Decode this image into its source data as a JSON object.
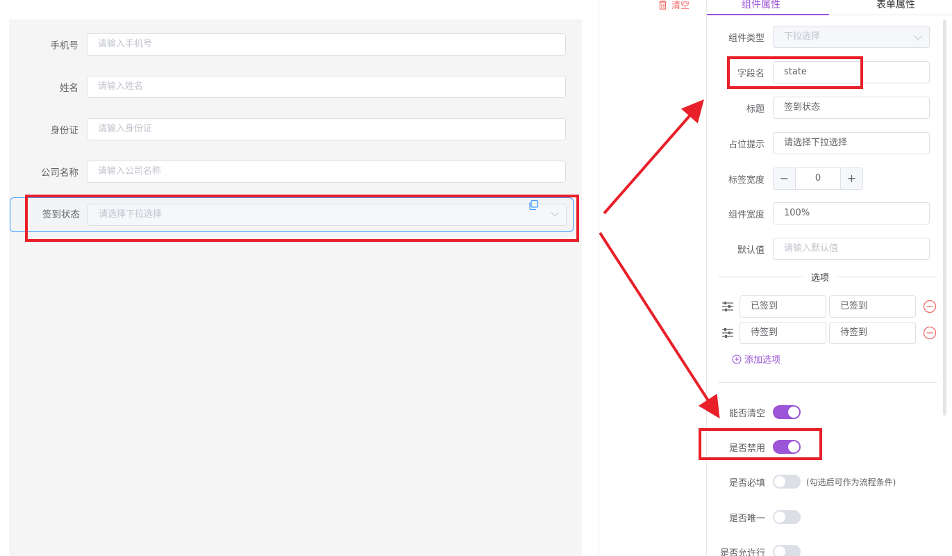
{
  "canvas": {
    "fields": [
      {
        "label": "手机号",
        "placeholder": "请输入手机号"
      },
      {
        "label": "姓名",
        "placeholder": "请输入姓名"
      },
      {
        "label": "身份证",
        "placeholder": "请输入身份证"
      },
      {
        "label": "公司名称",
        "placeholder": "请输入公司名称"
      }
    ],
    "selected": {
      "label": "签到状态",
      "placeholder": "请选择下拉选择"
    }
  },
  "toolbar": {
    "clear_label": "清空"
  },
  "panel": {
    "tabs": [
      {
        "label": "组件属性"
      },
      {
        "label": "表单属性"
      }
    ],
    "component_type": {
      "label": "组件类型",
      "value": "下拉选择"
    },
    "field_name": {
      "label": "字段名",
      "value": "state"
    },
    "title": {
      "label": "标题",
      "value": "签到状态"
    },
    "placeholder": {
      "label": "占位提示",
      "value": "请选择下拉选择"
    },
    "label_width": {
      "label": "标签宽度",
      "value": "0",
      "minus": "−",
      "plus": "+"
    },
    "component_width": {
      "label": "组件宽度",
      "value": "100%"
    },
    "default_value": {
      "label": "默认值",
      "placeholder": "请输入默认值"
    },
    "options_title": "选项",
    "options": [
      {
        "label": "已签到",
        "value": "已签到"
      },
      {
        "label": "待签到",
        "value": "待签到"
      }
    ],
    "add_option": "添加选项",
    "switches": [
      {
        "label": "能否清空",
        "on": true,
        "note": ""
      },
      {
        "label": "是否禁用",
        "on": true,
        "note": ""
      },
      {
        "label": "是否必填",
        "on": false,
        "note": "(勾选后可作为流程条件)"
      },
      {
        "label": "是否唯一",
        "on": false,
        "note": ""
      },
      {
        "label": "是否允许行",
        "on": false,
        "note": ""
      }
    ]
  },
  "colors": {
    "accent": "#9c55d6",
    "annotation": "#e8202a",
    "danger": "#f56c6c",
    "focus": "#409eff"
  }
}
